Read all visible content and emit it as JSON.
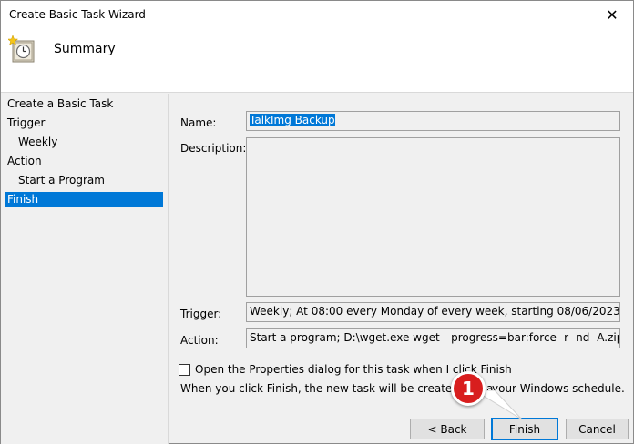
{
  "window": {
    "title": "Create Basic Task Wizard",
    "close_glyph": "✕"
  },
  "header": {
    "title": "Summary",
    "icon": "task-clock-icon"
  },
  "steps": [
    {
      "label": "Create a Basic Task",
      "sub": false,
      "active": false
    },
    {
      "label": "Trigger",
      "sub": false,
      "active": false
    },
    {
      "label": "Weekly",
      "sub": true,
      "active": false
    },
    {
      "label": "Action",
      "sub": false,
      "active": false
    },
    {
      "label": "Start a Program",
      "sub": true,
      "active": false
    },
    {
      "label": "Finish",
      "sub": false,
      "active": true
    }
  ],
  "form": {
    "name_label": "Name:",
    "name_value": "TalkImg Backup",
    "description_label": "Description:",
    "trigger_label": "Trigger:",
    "trigger_value": "Weekly; At 08:00 every Monday of every week, starting 08/06/2023",
    "action_label": "Action:",
    "action_value": "Start a program; D:\\wget.exe wget --progress=bar:force -r -nd -A.zip -np -P '",
    "checkbox_label": "Open the Properties dialog for this task when I click Finish",
    "checkbox_checked": false,
    "info_text_left": "When you click Finish, the new task will be created and a",
    "info_text_right": "your Windows schedule."
  },
  "buttons": {
    "back": "< Back",
    "finish": "Finish",
    "cancel": "Cancel"
  },
  "annotation": {
    "badge_number": "1",
    "badge_color": "#d81e1e"
  },
  "colors": {
    "accent": "#0078d7"
  }
}
